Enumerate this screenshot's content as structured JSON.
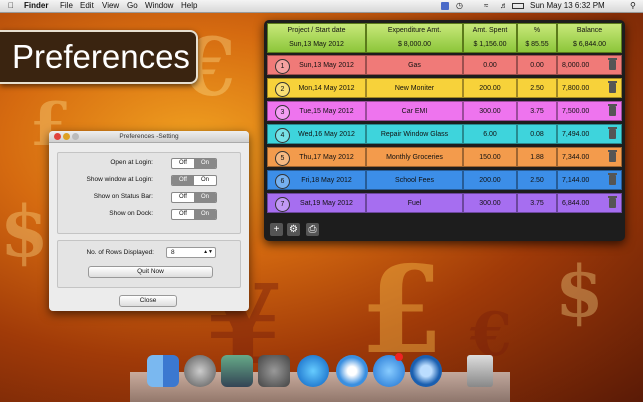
{
  "menubar": {
    "app": "Finder",
    "items": [
      "File",
      "Edit",
      "View",
      "Go",
      "Window",
      "Help"
    ],
    "clock": "Sun May 13  6:32 PM"
  },
  "banner": {
    "title": "Preferences"
  },
  "settings": {
    "title": "Preferences -Setting",
    "rows": [
      {
        "label": "Open at Login:",
        "off": "Off",
        "on": "On",
        "selected": "on"
      },
      {
        "label": "Show window at Login:",
        "off": "Off",
        "on": "On",
        "selected": "off"
      },
      {
        "label": "Show on Status Bar:",
        "off": "Off",
        "on": "On",
        "selected": "on"
      },
      {
        "label": "Show on Dock:",
        "off": "Off",
        "on": "On",
        "selected": "on"
      }
    ],
    "rows_label": "No. of Rows Displayed:",
    "rows_value": "8",
    "quit_label": "Quit Now",
    "close_label": "Close"
  },
  "table": {
    "headers": [
      {
        "label": "Project / Start date",
        "sub": "Sun,13 May 2012"
      },
      {
        "label": "Expenditure Amt.",
        "sub": "$ 8,000.00"
      },
      {
        "label": "Amt. Spent",
        "sub": "$ 1,156.00"
      },
      {
        "label": "%",
        "sub": "$ 85.55"
      },
      {
        "label": "Balance",
        "sub": "$ 6,844.00"
      }
    ],
    "rows": [
      {
        "num": "1",
        "date": "Sun,13 May 2012",
        "item": "Gas",
        "spent": "0.00",
        "pct": "0.00",
        "balance": "8,000.00",
        "color": "#f07a78"
      },
      {
        "num": "2",
        "date": "Mon,14 May 2012",
        "item": "New Moniter",
        "spent": "200.00",
        "pct": "2.50",
        "balance": "7,800.00",
        "color": "#f7d23a"
      },
      {
        "num": "3",
        "date": "Tue,15 May 2012",
        "item": "Car EMI",
        "spent": "300.00",
        "pct": "3.75",
        "balance": "7,500.00",
        "color": "#ee74ee"
      },
      {
        "num": "4",
        "date": "Wed,16 May 2012",
        "item": "Repair Window Glass",
        "spent": "6.00",
        "pct": "0.08",
        "balance": "7,494.00",
        "color": "#3ed4dc"
      },
      {
        "num": "5",
        "date": "Thu,17 May 2012",
        "item": "Monthly Groceries",
        "spent": "150.00",
        "pct": "1.88",
        "balance": "7,344.00",
        "color": "#f39b4c"
      },
      {
        "num": "6",
        "date": "Fri,18 May 2012",
        "item": "School Fees",
        "spent": "200.00",
        "pct": "2.50",
        "balance": "7,144.00",
        "color": "#3c8ee8"
      },
      {
        "num": "7",
        "date": "Sat,19 May 2012",
        "item": "Fuel",
        "spent": "300.00",
        "pct": "3.75",
        "balance": "6,844.00",
        "color": "#a66ef0"
      }
    ]
  },
  "icons": [
    "add-icon",
    "gear-icon",
    "print-icon",
    "trash-icon"
  ],
  "dock_apps": [
    "finder",
    "launchpad",
    "photo-app",
    "system-preferences",
    "itunes",
    "safari",
    "app-store",
    "quicktime",
    "trash"
  ]
}
